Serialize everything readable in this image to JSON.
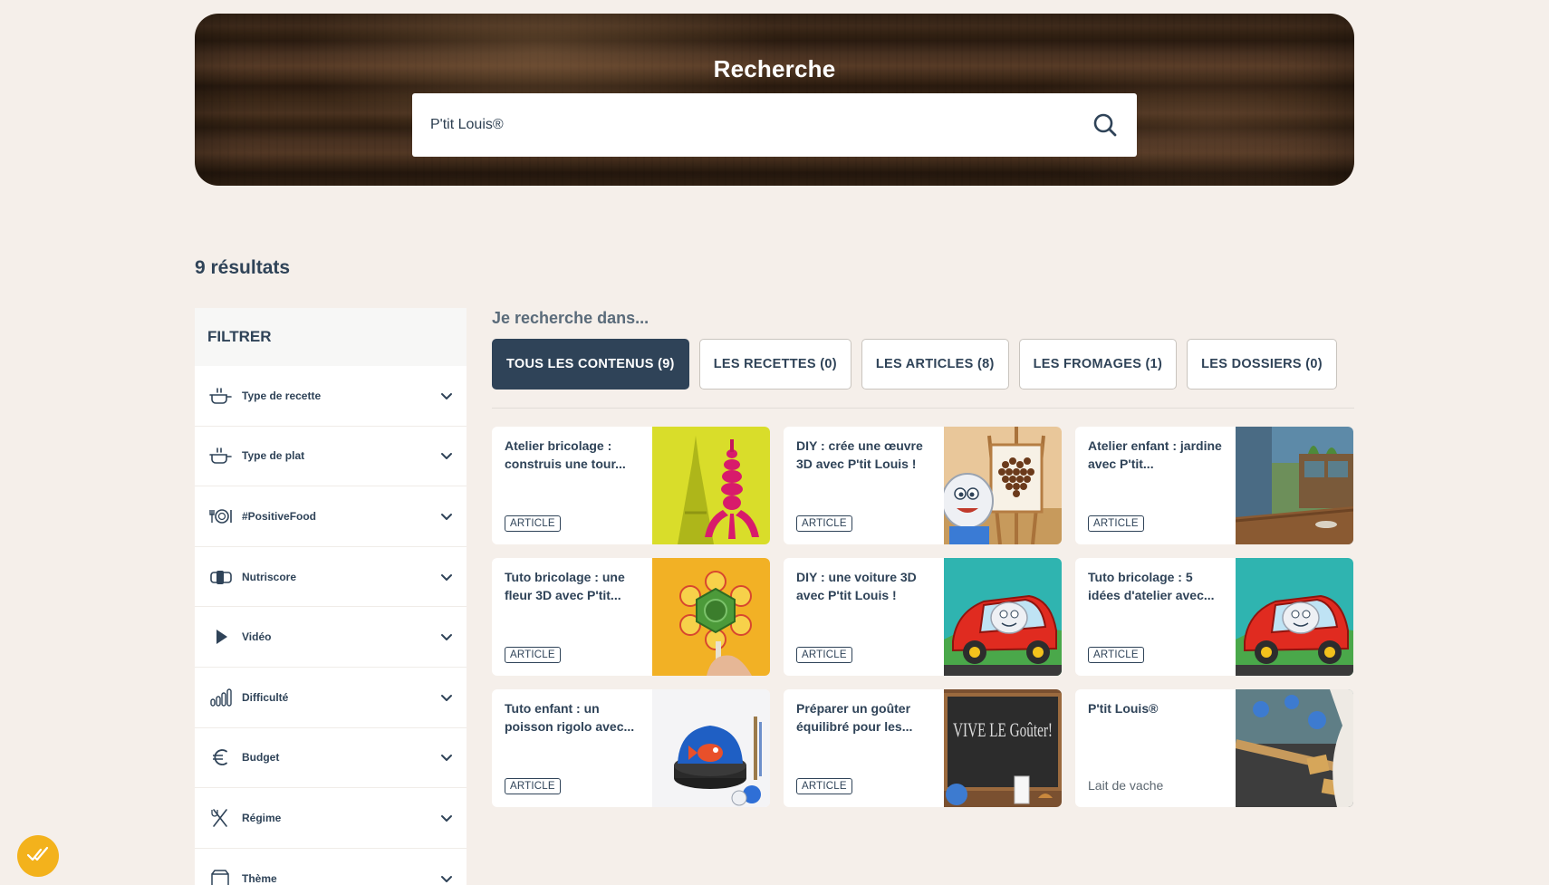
{
  "hero": {
    "title": "Recherche",
    "search_value": "P'tit Louis®"
  },
  "results": {
    "count_label": "9 résultats"
  },
  "sidebar": {
    "title": "FILTRER",
    "filters": [
      {
        "label": "Type de recette",
        "icon": "cooking-pot-icon"
      },
      {
        "label": "Type de plat",
        "icon": "cooking-pot-icon"
      },
      {
        "label": "#PositiveFood",
        "icon": "plate-icon"
      },
      {
        "label": "Nutriscore",
        "icon": "nutriscore-icon"
      },
      {
        "label": "Vidéo",
        "icon": "play-icon"
      },
      {
        "label": "Difficulté",
        "icon": "difficulty-bars-icon"
      },
      {
        "label": "Budget",
        "icon": "euro-icon"
      },
      {
        "label": "Régime",
        "icon": "cutlery-icon"
      },
      {
        "label": "Thème",
        "icon": "theme-icon"
      }
    ]
  },
  "content": {
    "search_in_label": "Je recherche dans...",
    "tabs": [
      {
        "label": "TOUS LES CONTENUS (9)",
        "active": true
      },
      {
        "label": "LES RECETTES (0)",
        "active": false
      },
      {
        "label": "LES ARTICLES (8)",
        "active": false
      },
      {
        "label": "LES FROMAGES (1)",
        "active": false
      },
      {
        "label": "LES DOSSIERS (0)",
        "active": false
      }
    ],
    "cards": [
      {
        "title": "Atelier bricolage : construis une tour...",
        "badge": "ARTICLE"
      },
      {
        "title": "DIY : crée une œuvre 3D avec P'tit Louis !",
        "badge": "ARTICLE"
      },
      {
        "title": "Atelier enfant : jardine avec P'tit...",
        "badge": "ARTICLE"
      },
      {
        "title": "Tuto bricolage : une fleur 3D avec P'tit...",
        "badge": "ARTICLE"
      },
      {
        "title": "DIY : une voiture 3D avec P'tit Louis !",
        "badge": "ARTICLE"
      },
      {
        "title": "Tuto bricolage : 5 idées d'atelier avec...",
        "badge": "ARTICLE"
      },
      {
        "title": "Tuto enfant : un poisson rigolo avec...",
        "badge": "ARTICLE"
      },
      {
        "title": "Préparer un goûter équilibré pour les...",
        "badge": "ARTICLE"
      },
      {
        "title": "P'tit Louis®",
        "subtitle": "Lait de vache"
      }
    ],
    "chalkboard_text": "VIVE LE Goûter!"
  },
  "colors": {
    "navy": "#2f4358",
    "background": "#f5efea",
    "accent_yellow": "#f3b21c"
  }
}
